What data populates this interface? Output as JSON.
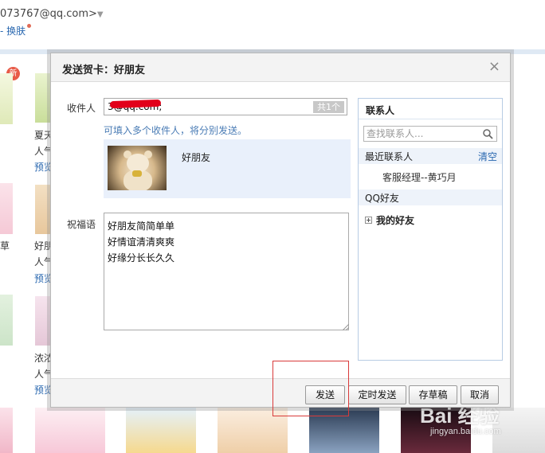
{
  "background": {
    "account_email": "073767@qq.com>",
    "skin_link": "换肤",
    "new_badge": "新",
    "labels": {
      "row1_title": "夏天",
      "row1_pop": "人气",
      "row1_preview": "预览",
      "row2_edge": "草",
      "row2_title": "好朋",
      "row2_pop": "人气",
      "row2_preview": "预览",
      "row3_title": "浓浓",
      "row3_pop": "人气",
      "row3_preview": "预览"
    },
    "watermark": "Bai 经验",
    "watermark_sub": "jingyan.baidu.com"
  },
  "dialog": {
    "title": "发送贺卡：好朋友",
    "close_glyph": "×",
    "recipient_label": "收件人",
    "recipient_value": "    3@qq.com;",
    "recipient_count": "共1个",
    "hint": "可填入多个收件人，将分别发送。",
    "card_name": "好朋友",
    "greeting_label": "祝福语",
    "greeting_text": "好朋友简简单单\n好情谊清清爽爽\n好缘分长长久久",
    "contacts": {
      "title": "联系人",
      "search_placeholder": "查找联系人...",
      "recent_label": "最近联系人",
      "clear_label": "清空",
      "recent_items": [
        "客服经理--黄巧月"
      ],
      "qq_friends_label": "QQ好友",
      "group_label": "我的好友"
    },
    "buttons": {
      "send": "发送",
      "schedule": "定时发送",
      "draft": "存草稿",
      "cancel": "取消"
    }
  },
  "colors": {
    "link": "#2a68b0",
    "highlight": "#d93a3a",
    "badge": "#e85a47"
  }
}
